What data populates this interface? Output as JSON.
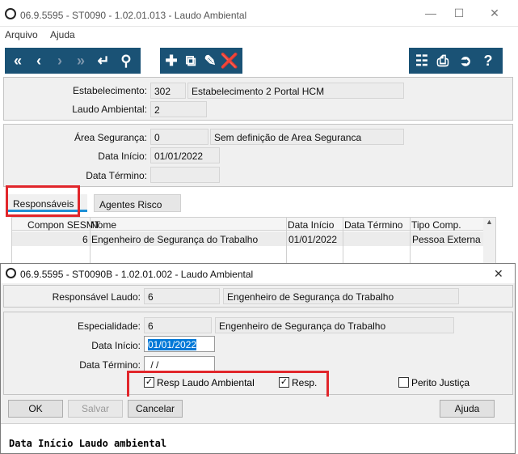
{
  "main_window": {
    "title": "06.9.5595 - ST0090 - 1.02.01.013 - Laudo Ambiental",
    "menu": [
      "Arquivo",
      "Ajuda"
    ]
  },
  "header_fields": {
    "estabelecimento_label": "Estabelecimento:",
    "estabelecimento_code": "302",
    "estabelecimento_name": "Estabelecimento 2 Portal HCM",
    "laudo_label": "Laudo Ambiental:",
    "laudo_value": "2"
  },
  "area_fields": {
    "area_label": "Área Segurança:",
    "area_code": "0",
    "area_desc": "Sem definição de Area Seguranca",
    "data_inicio_label": "Data Início:",
    "data_inicio_value": "01/01/2022",
    "data_termino_label": "Data Término:",
    "data_termino_value": ""
  },
  "tabs": [
    "Responsáveis",
    "Agentes Risco"
  ],
  "grid": {
    "headers": [
      "Compon SESMT",
      "Nome",
      "Data Início",
      "Data Término",
      "Tipo Comp."
    ],
    "rows": [
      [
        "6",
        "Engenheiro de Segurança do Trabalho",
        "01/01/2022",
        "",
        "Pessoa Externa"
      ]
    ]
  },
  "dialog": {
    "title": "06.9.5595 - ST0090B - 1.02.01.002 - Laudo Ambiental",
    "responsavel_label": "Responsável Laudo:",
    "responsavel_code": "6",
    "responsavel_name": "Engenheiro de Segurança do Trabalho",
    "especialidade_label": "Especialidade:",
    "especialidade_code": "6",
    "especialidade_name": "Engenheiro de Segurança do Trabalho",
    "data_inicio_label": "Data Início:",
    "data_inicio_value": "01/01/2022",
    "data_termino_label": "Data Término:",
    "data_termino_value": " / /",
    "chk_resp_laudo": "Resp Laudo Ambiental",
    "chk_resp": "Resp.",
    "chk_perito": "Perito Justiça",
    "btn_ok": "OK",
    "btn_salvar": "Salvar",
    "btn_cancelar": "Cancelar",
    "btn_ajuda": "Ajuda",
    "status": "Data Início Laudo ambiental"
  },
  "colors": {
    "toolbar": "#1a5275",
    "highlight": "#e1262b",
    "selection": "#0078d7"
  }
}
